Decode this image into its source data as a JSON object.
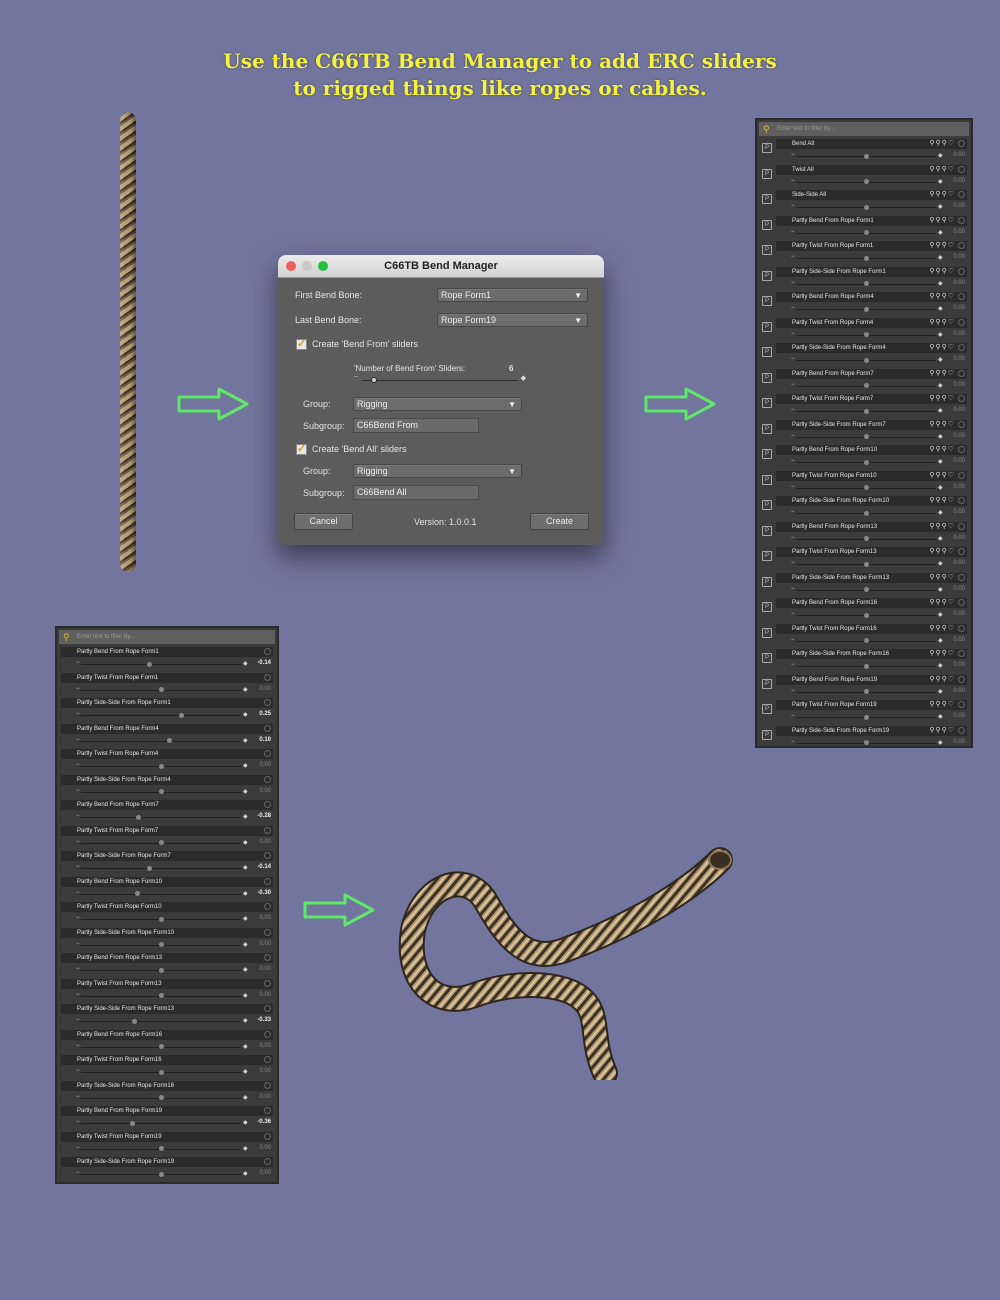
{
  "headline": {
    "line1": "Use the C66TB Bend Manager to add ERC sliders",
    "line2": "to rigged things like ropes or cables."
  },
  "colors": {
    "background": "#72759e",
    "headline": "#f4f23a",
    "arrow": "#5fe86a"
  },
  "dialog": {
    "title": "C66TB Bend Manager",
    "first_bend_bone_label": "First Bend Bone:",
    "first_bend_bone_value": "Rope Form1",
    "last_bend_bone_label": "Last Bend Bone:",
    "last_bend_bone_value": "Rope Form19",
    "create_bend_from_label": "Create 'Bend From' sliders",
    "number_sliders_label": "'Number of Bend From' Sliders:",
    "number_sliders_value": "6",
    "group1_label": "Group:",
    "group1_value": "Rigging",
    "subgroup1_label": "Subgroup:",
    "subgroup1_value": "C66Bend From",
    "create_bend_all_label": "Create 'Bend All' sliders",
    "group2_label": "Group:",
    "group2_value": "Rigging",
    "subgroup2_label": "Subgroup:",
    "subgroup2_value": "C66Bend All",
    "cancel_label": "Cancel",
    "version_label": "Version: 1.0.0.1",
    "create_label": "Create"
  },
  "right_panel": {
    "search_placeholder": "Enter text to filter by...",
    "items": [
      {
        "label": "Bend All",
        "value": "0.00"
      },
      {
        "label": "Twist All",
        "value": "0.00"
      },
      {
        "label": "Side-Side All",
        "value": "0.00"
      },
      {
        "label": "Partly Bend From Rope Form1",
        "value": "0.00"
      },
      {
        "label": "Partly Twist From Rope Form1",
        "value": "0.00"
      },
      {
        "label": "Partly Side-Side From Rope Form1",
        "value": "0.00"
      },
      {
        "label": "Partly Bend From Rope Form4",
        "value": "0.00"
      },
      {
        "label": "Partly Twist From Rope Form4",
        "value": "0.00"
      },
      {
        "label": "Partly Side-Side From Rope Form4",
        "value": "0.00"
      },
      {
        "label": "Partly Bend From Rope Form7",
        "value": "0.00"
      },
      {
        "label": "Partly Twist From Rope Form7",
        "value": "0.00"
      },
      {
        "label": "Partly Side-Side From Rope Form7",
        "value": "0.00"
      },
      {
        "label": "Partly Bend From Rope Form10",
        "value": "0.00"
      },
      {
        "label": "Partly Twist From Rope Form10",
        "value": "0.00"
      },
      {
        "label": "Partly Side-Side From Rope Form10",
        "value": "0.00"
      },
      {
        "label": "Partly Bend From Rope Form13",
        "value": "0.00"
      },
      {
        "label": "Partly Twist From Rope Form13",
        "value": "0.00"
      },
      {
        "label": "Partly Side-Side From Rope Form13",
        "value": "0.00"
      },
      {
        "label": "Partly Bend From Rope Form16",
        "value": "0.00"
      },
      {
        "label": "Partly Twist From Rope Form16",
        "value": "0.00"
      },
      {
        "label": "Partly Side-Side From Rope Form16",
        "value": "0.00"
      },
      {
        "label": "Partly Bend From Rope Form19",
        "value": "0.00"
      },
      {
        "label": "Partly Twist From Rope Form19",
        "value": "0.00"
      },
      {
        "label": "Partly Side-Side From Rope Form19",
        "value": "0.00"
      }
    ]
  },
  "left_panel": {
    "search_placeholder": "Enter text to filter by...",
    "items": [
      {
        "label": "Partly Bend From Rope Form1",
        "value": "-0.14",
        "set": true
      },
      {
        "label": "Partly Twist From Rope Form1",
        "value": "0.00",
        "set": false
      },
      {
        "label": "Partly Side-Side From Rope Form1",
        "value": "0.25",
        "set": true
      },
      {
        "label": "Partly Bend From Rope Form4",
        "value": "0.10",
        "set": true
      },
      {
        "label": "Partly Twist From Rope Form4",
        "value": "0.00",
        "set": false
      },
      {
        "label": "Partly Side-Side From Rope Form4",
        "value": "0.00",
        "set": false
      },
      {
        "label": "Partly Bend From Rope Form7",
        "value": "-0.28",
        "set": true
      },
      {
        "label": "Partly Twist From Rope Form7",
        "value": "0.00",
        "set": false
      },
      {
        "label": "Partly Side-Side From Rope Form7",
        "value": "-0.14",
        "set": true
      },
      {
        "label": "Partly Bend From Rope Form10",
        "value": "-0.30",
        "set": true
      },
      {
        "label": "Partly Twist From Rope Form10",
        "value": "0.00",
        "set": false
      },
      {
        "label": "Partly Side-Side From Rope Form10",
        "value": "0.00",
        "set": false
      },
      {
        "label": "Partly Bend From Rope Form13",
        "value": "0.00",
        "set": false
      },
      {
        "label": "Partly Twist From Rope Form13",
        "value": "0.00",
        "set": false
      },
      {
        "label": "Partly Side-Side From Rope Form13",
        "value": "-0.33",
        "set": true
      },
      {
        "label": "Partly Bend From Rope Form16",
        "value": "0.00",
        "set": false
      },
      {
        "label": "Partly Twist From Rope Form16",
        "value": "0.00",
        "set": false
      },
      {
        "label": "Partly Side-Side From Rope Form16",
        "value": "0.00",
        "set": false
      },
      {
        "label": "Partly Bend From Rope Form19",
        "value": "-0.36",
        "set": true
      },
      {
        "label": "Partly Twist From Rope Form19",
        "value": "0.00",
        "set": false
      },
      {
        "label": "Partly Side-Side From Rope Form19",
        "value": "0.00",
        "set": false
      }
    ]
  }
}
